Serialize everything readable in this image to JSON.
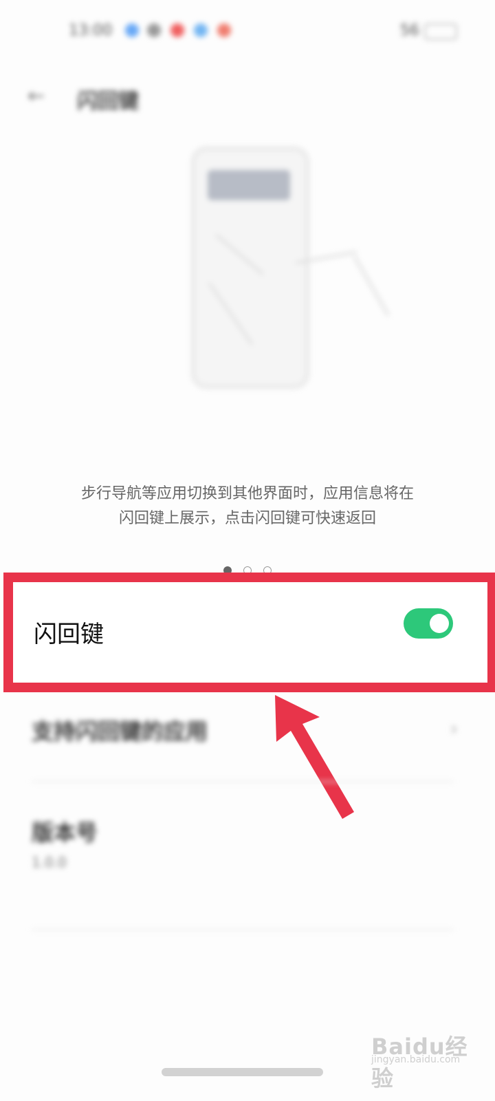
{
  "status_bar": {
    "time": "13:00",
    "right_text": "56",
    "dot_colors": [
      "#69a9f6",
      "#9a9a9a",
      "#f06060",
      "#74b6f2",
      "#f07e70"
    ]
  },
  "header": {
    "back_icon": "back-arrow-icon",
    "title": "闪回键"
  },
  "illustration": {
    "description_icon": "phone-gesture-illustration"
  },
  "description": {
    "line1": "步行导航等应用切换到其他界面时，应用信息将在",
    "line2": "闪回键上展示，点击闪回键可快速返回"
  },
  "pager": {
    "count": 3,
    "active_index": 0
  },
  "toggle": {
    "label": "闪回键",
    "enabled": true,
    "on_color": "#2dc87a"
  },
  "annotation": {
    "highlight_color": "#e8344a",
    "arrow_color": "#e8344a"
  },
  "settings": {
    "supported_apps": "支持闪回键的应用",
    "version_label": "版本号",
    "version_value": "1.0.0",
    "version_sub": ""
  },
  "watermark": {
    "brand": "Baidu经验",
    "url": "jingyan.baidu.com"
  }
}
